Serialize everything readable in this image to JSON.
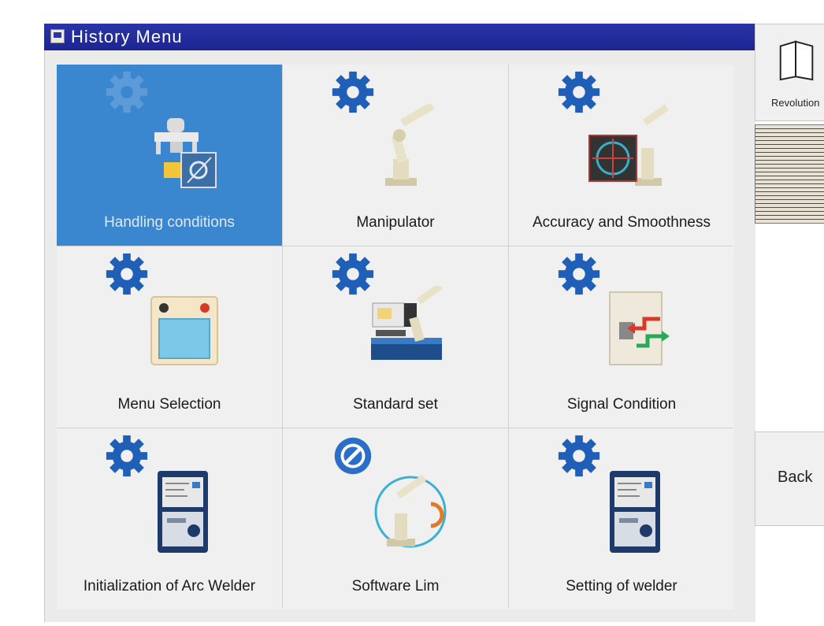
{
  "window": {
    "title": "History Menu"
  },
  "tiles": [
    {
      "label": "Handling conditions",
      "icon": "handling-icon",
      "selected": true
    },
    {
      "label": "Manipulator",
      "icon": "robot-arm-icon"
    },
    {
      "label": "Accuracy and Smoothness",
      "icon": "accuracy-icon"
    },
    {
      "label": "Menu Selection",
      "icon": "panel-icon"
    },
    {
      "label": "Standard set",
      "icon": "standard-set-icon"
    },
    {
      "label": "Signal Condition",
      "icon": "signal-icon"
    },
    {
      "label": "Initialization of Arc Welder",
      "icon": "welder-icon"
    },
    {
      "label": "Software Lim",
      "icon": "software-limit-icon"
    },
    {
      "label": "Setting of welder",
      "icon": "welder-icon"
    }
  ],
  "sidebar": {
    "top_label": "Revolution",
    "back_label": "Back"
  },
  "colors": {
    "titlebar": "#1c2590",
    "selected_tile": "#3a86cf",
    "gear": "#1f5fb8"
  }
}
